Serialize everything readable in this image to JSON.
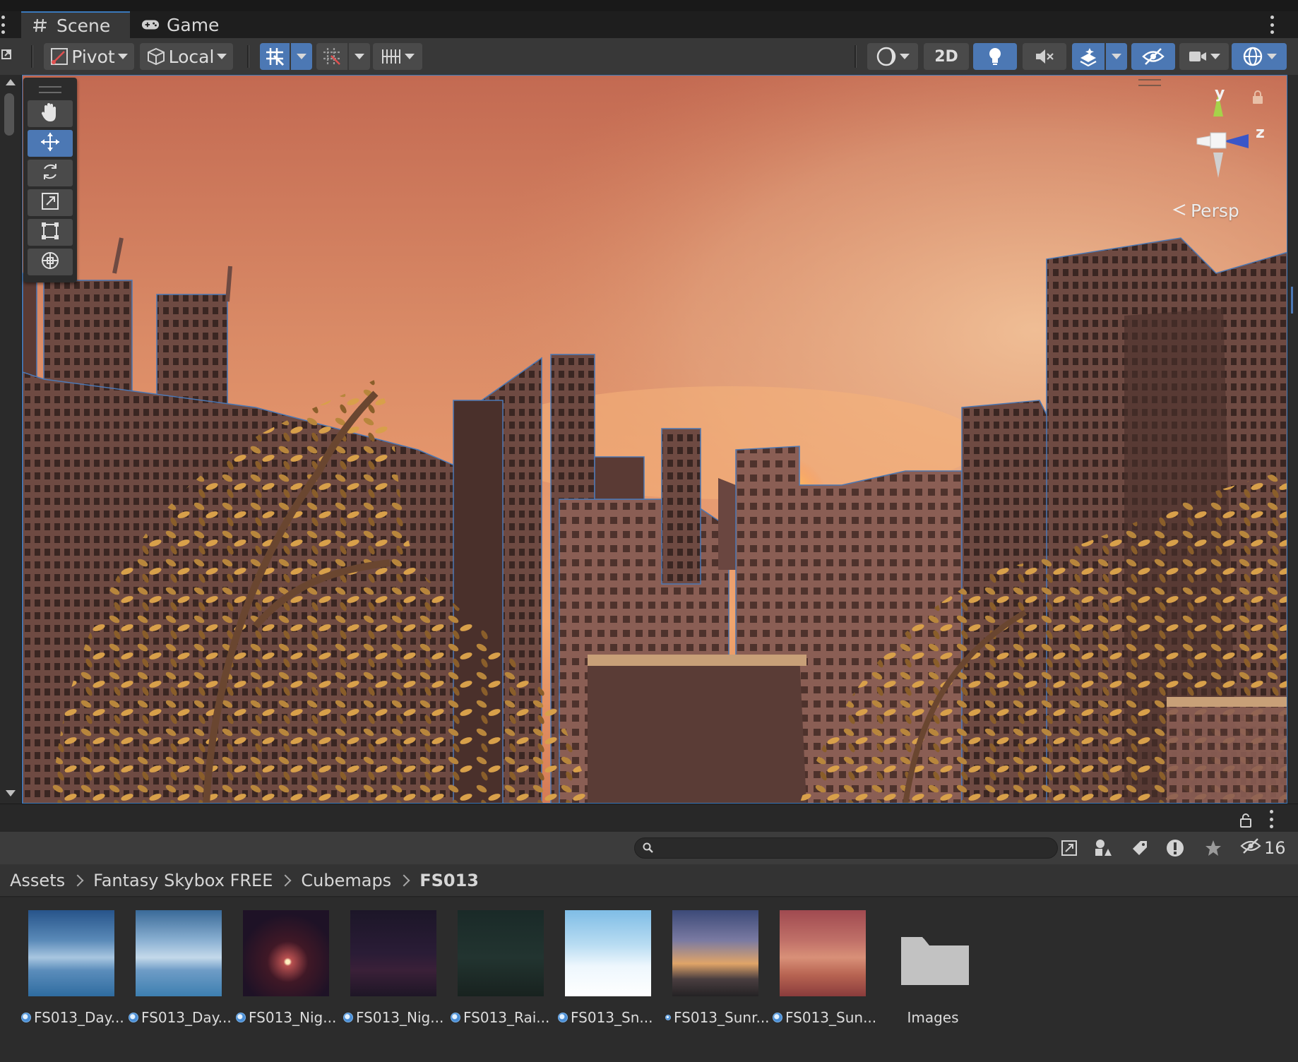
{
  "tabs": [
    {
      "label": "Scene",
      "icon": "hash-icon",
      "active": true
    },
    {
      "label": "Game",
      "icon": "gamepad-icon",
      "active": false
    }
  ],
  "toolbar": {
    "pivot_label": "Pivot",
    "local_label": "Local",
    "mode_2d_label": "2D"
  },
  "scene": {
    "projection_label": "Persp",
    "axis_y": "y",
    "axis_z": "z"
  },
  "project": {
    "hidden_count": "16",
    "breadcrumb": [
      "Assets",
      "Fantasy Skybox FREE",
      "Cubemaps",
      "FS013"
    ],
    "assets": [
      {
        "label": "FS013_Day...",
        "kind": "cubemap"
      },
      {
        "label": "FS013_Day...",
        "kind": "cubemap"
      },
      {
        "label": "FS013_Nig...",
        "kind": "cubemap"
      },
      {
        "label": "FS013_Nig...",
        "kind": "cubemap"
      },
      {
        "label": "FS013_Rai...",
        "kind": "cubemap"
      },
      {
        "label": "FS013_Sn...",
        "kind": "cubemap"
      },
      {
        "label": "FS013_Sunr...",
        "kind": "cubemap"
      },
      {
        "label": "FS013_Sun...",
        "kind": "cubemap"
      },
      {
        "label": "Images",
        "kind": "folder"
      }
    ]
  },
  "colors": {
    "accent": "#4c78b4",
    "panel": "#383838",
    "background": "#282828"
  }
}
